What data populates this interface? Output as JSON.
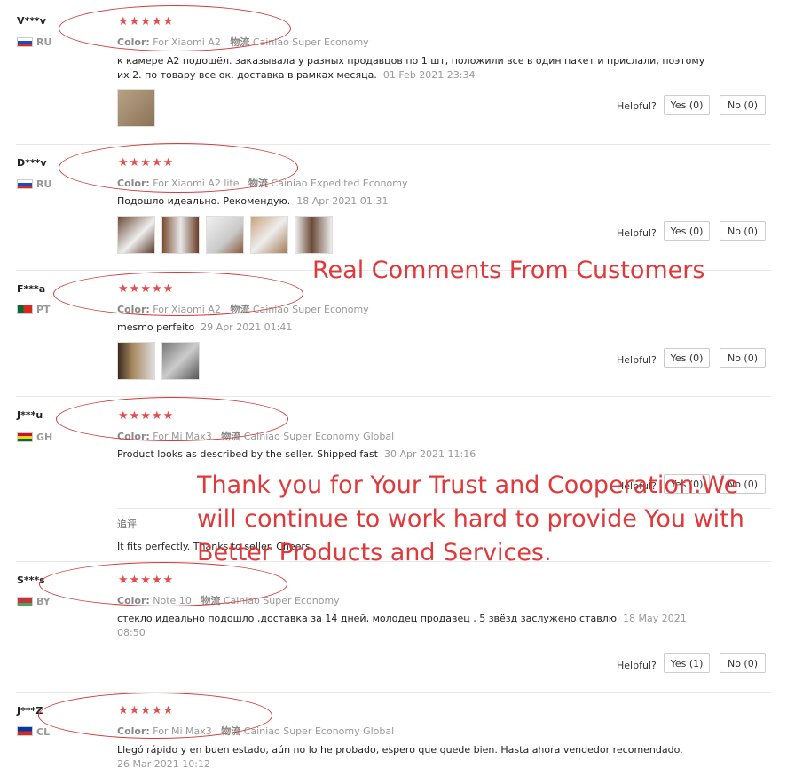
{
  "reviews": [
    {
      "user": "V***v",
      "country": "RU",
      "stars": "★★★★★",
      "color_label": "Color:",
      "color": "For Xiaomi A2",
      "logistics_label": "物流",
      "logistics": "Cainiao Super Economy",
      "text1": "к камере А2 подошёл. заказывала у разных продавцов по 1 шт, положили все в один пакет и прислали, поэтому",
      "text2": "их 2. по товару все ок. доставка в рамках месяца.",
      "date": "01 Feb 2021 23:34",
      "helpful": "Helpful?",
      "yes": "Yes (0)",
      "no": "No (0)"
    },
    {
      "user": "D***v",
      "country": "RU",
      "stars": "★★★★★",
      "color_label": "Color:",
      "color": "For Xiaomi A2 lite",
      "logistics_label": "物流",
      "logistics": "Cainiao Expedited Economy",
      "text1": "Подошло идеально. Рекомендую.",
      "date": "18 Apr 2021 01:31",
      "helpful": "Helpful?",
      "yes": "Yes (0)",
      "no": "No (0)"
    },
    {
      "user": "F***a",
      "country": "PT",
      "stars": "★★★★★",
      "color_label": "Color:",
      "color": "For Xiaomi A2",
      "logistics_label": "物流",
      "logistics": "Cainiao Super Economy",
      "text1": "mesmo perfeito",
      "date": "29 Apr 2021 01:41",
      "helpful": "Helpful?",
      "yes": "Yes (0)",
      "no": "No (0)"
    },
    {
      "user": "J***u",
      "country": "GH",
      "stars": "★★★★★",
      "color_label": "Color:",
      "color": "For Mi Max3",
      "logistics_label": "物流",
      "logistics": "Cainiao Super Economy Global",
      "text1": "Product looks as described by the seller. Shipped fast",
      "date": "30 Apr 2021 11:16",
      "helpful": "Helpful?",
      "yes": "Yes (0)",
      "no": "No (0)",
      "followup_label": "追评",
      "followup": "It fits perfectly. Thanks to seller. Cheers"
    },
    {
      "user": "S***s",
      "country": "BY",
      "stars": "★★★★★",
      "color_label": "Color:",
      "color": "Note 10",
      "logistics_label": "物流",
      "logistics": "Cainiao Super Economy",
      "text1": "стекло идеально подошло ,доставка за 14 дней, молодец продавец , 5 звёзд заслужено ставлю",
      "date": "18 May 2021",
      "date2": "08:50",
      "helpful": "Helpful?",
      "yes": "Yes (1)",
      "no": "No (0)"
    },
    {
      "user": "J***Z",
      "country": "CL",
      "stars": "★★★★★",
      "color_label": "Color:",
      "color": "For Mi Max3",
      "logistics_label": "物流",
      "logistics": "Cainiao Super Economy Global",
      "text1": "Llegó rápido y en buen estado, aún no lo he probado, espero que quede bien. Hasta ahora vendedor recomendado.",
      "date": "26 Mar 2021 10:12"
    }
  ],
  "overlay": {
    "headline": "Real Comments From Customers",
    "line1": "Thank you for Your Trust and Cooperation.We",
    "line2": "will continue to work hard to provide You with",
    "line3": "Better Products and Services."
  },
  "colors": {
    "star": "#e94b4b",
    "overlay": "#e0393b",
    "oval": "#d23b3b"
  }
}
